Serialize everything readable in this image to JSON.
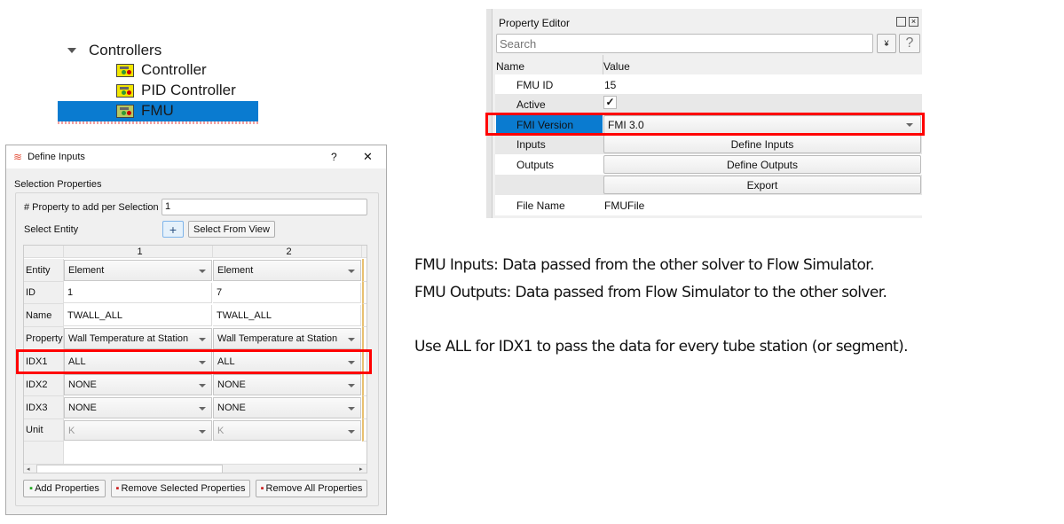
{
  "tree": {
    "group": "Controllers",
    "items": [
      "Controller",
      "PID Controller",
      "FMU"
    ]
  },
  "dialog": {
    "title": "Define Inputs",
    "help": "?",
    "close": "✕",
    "section": "Selection Properties",
    "prop_per_sel_label": "# Property to add per Selection",
    "prop_per_sel_value": "1",
    "select_entity_label": "Select Entity",
    "plus": "+",
    "select_from_view": "Select From View",
    "columns": [
      "1",
      "2"
    ],
    "rows": [
      {
        "label": "Entity",
        "type": "combo",
        "values": [
          "Element",
          "Element"
        ]
      },
      {
        "label": "ID",
        "type": "text",
        "values": [
          "1",
          "7"
        ]
      },
      {
        "label": "Name",
        "type": "text",
        "values": [
          "TWALL_ALL",
          "TWALL_ALL"
        ]
      },
      {
        "label": "Property",
        "type": "combo",
        "values": [
          "Wall Temperature at Station",
          "Wall Temperature at Station"
        ]
      },
      {
        "label": "IDX1",
        "type": "combo",
        "values": [
          "ALL",
          "ALL"
        ]
      },
      {
        "label": "IDX2",
        "type": "combo",
        "values": [
          "NONE",
          "NONE"
        ]
      },
      {
        "label": "IDX3",
        "type": "combo",
        "values": [
          "NONE",
          "NONE"
        ]
      },
      {
        "label": "Unit",
        "type": "combo-disabled",
        "values": [
          "K",
          "K"
        ]
      }
    ],
    "add_properties": "Add Properties",
    "remove_selected": "Remove Selected Properties",
    "remove_all": "Remove All Properties"
  },
  "property_editor": {
    "title": "Property Editor",
    "search_placeholder": "Search",
    "help": "?",
    "col_name": "Name",
    "col_value": "Value",
    "fmu_id_label": "FMU ID",
    "fmu_id": "15",
    "active_label": "Active",
    "active_check": "✓",
    "fmi_version_label": "FMI Version",
    "fmi_version": "FMI 3.0",
    "inputs_label": "Inputs",
    "define_inputs": "Define Inputs",
    "outputs_label": "Outputs",
    "define_outputs": "Define Outputs",
    "export": "Export",
    "file_name_label": "File Name",
    "file_name": "FMUFile"
  },
  "notes": [
    "FMU Inputs: Data passed from the other solver to Flow Simulator.",
    "FMU Outputs: Data passed from Flow Simulator to the other solver.",
    "Use ALL for IDX1 to pass the data for every tube station (or segment)."
  ],
  "colors": {
    "selection": "#0a7bd0",
    "highlight": "#ff0000"
  }
}
